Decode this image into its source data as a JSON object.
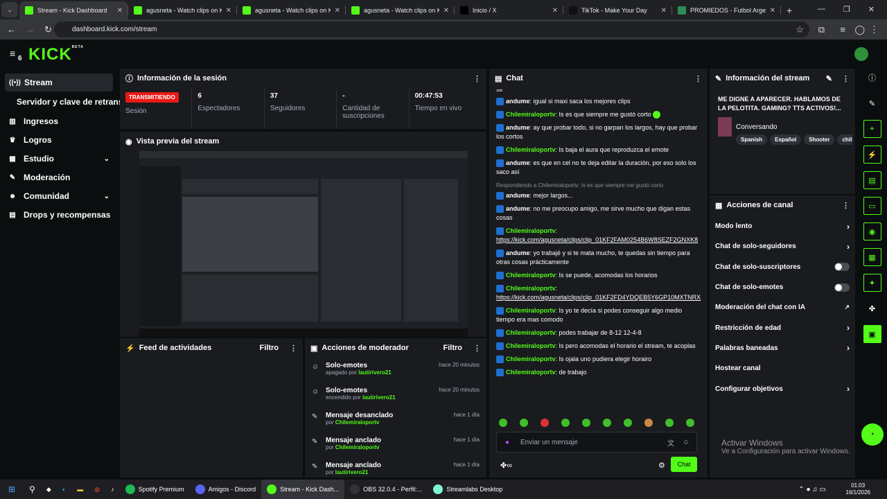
{
  "browser": {
    "tabs": [
      {
        "title": "Stream - Kick Dashboard",
        "color": "#53fc18"
      },
      {
        "title": "agusneta - Watch clips on Kick",
        "color": "#53fc18"
      },
      {
        "title": "agusneta - Watch clips on Kick",
        "color": "#53fc18"
      },
      {
        "title": "agusneta - Watch clips on Kick",
        "color": "#53fc18"
      },
      {
        "title": "Inicio / X",
        "color": "#000000"
      },
      {
        "title": "TikTok - Make Your Day",
        "color": "#111111"
      },
      {
        "title": "PROMIEDOS - Futbol Argentin...",
        "color": "#2e8b57"
      }
    ],
    "url": "dashboard.kick.com/stream"
  },
  "logo": "KICK",
  "logo_beta": "BETA",
  "sidebar": {
    "items": [
      {
        "label": "Stream",
        "icon": "broadcast-icon",
        "selected": true
      },
      {
        "label": "Servidor y clave de retransm",
        "icon": "",
        "selected": false
      },
      {
        "label": "Ingresos",
        "icon": "chart-icon"
      },
      {
        "label": "Logros",
        "icon": "trophy-icon"
      },
      {
        "label": "Estudio",
        "icon": "grid-icon",
        "chevron": true
      },
      {
        "label": "Moderación",
        "icon": "wrench-icon"
      },
      {
        "label": "Comunidad",
        "icon": "people-icon",
        "chevron": true
      },
      {
        "label": "Drops y recompensas",
        "icon": "gift-icon"
      }
    ]
  },
  "session": {
    "title": "Información de la sesión",
    "badge": "TRANSMITIENDO",
    "badge_label": "Sesión",
    "stats": [
      {
        "v": "6",
        "l": "Espectadores"
      },
      {
        "v": "37",
        "l": "Seguidores"
      },
      {
        "v": "-",
        "l": "Cantidad de suscripciones"
      },
      {
        "v": "00:47:53",
        "l": "Tiempo en vivo"
      }
    ]
  },
  "preview": {
    "title": "Vista previa del stream"
  },
  "feed": {
    "title": "Feed de actividades",
    "filter": "Filtro"
  },
  "mod": {
    "title": "Acciones de moderador",
    "filter": "Filtro",
    "rows": [
      {
        "t": "Solo-emotes",
        "pre": "apagado por",
        "u": "lautirivero21",
        "time": "hace 20 minutos"
      },
      {
        "t": "Solo-emotes",
        "pre": "encendido por",
        "u": "lautirivero21",
        "time": "hace 20 minutos"
      },
      {
        "t": "Mensaje desanclado",
        "pre": "por",
        "u": "Chilemiraloportv",
        "time": "hace 1 día"
      },
      {
        "t": "Mensaje anclado",
        "pre": "por",
        "u": "Chilemiraloportv",
        "time": "hace 1 día"
      },
      {
        "t": "Mensaje anclado",
        "pre": "por",
        "u": "lautirivero21",
        "time": "hace 1 día"
      }
    ]
  },
  "chat": {
    "title": "Chat",
    "top": "se",
    "messages": [
      {
        "u": "andume",
        "t": ": igual si maxi saca los mejores clips"
      },
      {
        "u": "Chilemiraloportv",
        "g": true,
        "t": ": Is es que siempre me gustó corto",
        "emo": true
      },
      {
        "u": "andume",
        "t": ": ay que probar todo, si no garpan los largos, hay que probar los cortos"
      },
      {
        "u": "Chilemiraloportv",
        "g": true,
        "t": ": Is baja el aura que reproduzca el emote"
      },
      {
        "u": "andume",
        "t": ": es que en cel no te deja editar la duración, por eso solo los saco así"
      },
      {
        "reply": "Respondiendo a Chilemiraloportv: Is es que siempre me gustó corto",
        "u": "andume",
        "t": ": mejor largos..."
      },
      {
        "u": "andume",
        "t": ": no me preocupo amigo, me sirve mucho que digan estas cosas"
      },
      {
        "u": "Chilemiraloportv",
        "g": true,
        "t": ":",
        "link": "https://kick.com/agusneta/clips/clip_01KF2FAM0254B6W8SEZF2GNXK8"
      },
      {
        "u": "andume",
        "t": ": yo trabajé y si te mata mucho, te quedas sin tiempo para otras cosas prácticamente"
      },
      {
        "u": "Chilemiraloportv",
        "g": true,
        "t": ": Is se puede, acomodas los horarios"
      },
      {
        "u": "Chilemiraloportv",
        "g": true,
        "t": ":",
        "link": "https://kick.com/agusneta/clips/clip_01KF2FD4YDQEB5Y6GP10MXTNRX"
      },
      {
        "u": "Chilemiraloportv",
        "g": true,
        "t": ": Is yo te decía si podes conseguir algo medio tiempo era mas comodo"
      },
      {
        "u": "Chilemiraloportv",
        "g": true,
        "t": ": podes trabajar de 8-12 12-4-8"
      },
      {
        "u": "Chilemiraloportv",
        "g": true,
        "t": ": Is pero acomodas el horario el stream, te acoplas"
      },
      {
        "u": "Chilemiraloportv",
        "g": true,
        "t": ": Is ojala uno pudiera elegir horairo"
      },
      {
        "u": "Chilemiraloportv",
        "g": true,
        "t": ": de trabajo"
      }
    ],
    "input_placeholder": "Enviar un mensaje",
    "send": "Chat"
  },
  "streaminfo": {
    "title": "Información del stream",
    "stream_title": "ME DIGNE A APARECER. HABLAMOS DE LA PELOTITA. GAMING? TTS ACTIVOS!...",
    "category": "Conversando",
    "tags": [
      "Spanish",
      "Español",
      "Shooter",
      "chill"
    ]
  },
  "actions": {
    "title": "Acciones de canal",
    "items": [
      {
        "l": "Modo lento",
        "k": "arrow"
      },
      {
        "l": "Chat de solo-seguidores",
        "k": "arrow"
      },
      {
        "l": "Chat de solo-suscriptores",
        "k": "toggle"
      },
      {
        "l": "Chat de solo-emotes",
        "k": "toggle"
      },
      {
        "l": "Moderación del chat con IA",
        "k": "ext"
      },
      {
        "l": "Restricción de edad",
        "k": "arrow"
      },
      {
        "l": "Palabras baneadas",
        "k": "arrow"
      },
      {
        "l": "Hostear canal",
        "k": "none"
      },
      {
        "l": "Configurar objetivos",
        "k": "arrow"
      }
    ]
  },
  "activate": {
    "title": "Activar Windows",
    "sub": "Ve a Configuración para activar Windows."
  },
  "taskbar": {
    "apps": [
      "Spotify Premium",
      "Amigos - Discord",
      "Stream - Kick Dash...",
      "OBS 32.0.4 - Perfil:...",
      "Streamlabs Desktop"
    ],
    "time": "01:03",
    "date": "16/1/2026"
  },
  "colors": {
    "accent": "#53fc18",
    "live": "#e91916"
  }
}
